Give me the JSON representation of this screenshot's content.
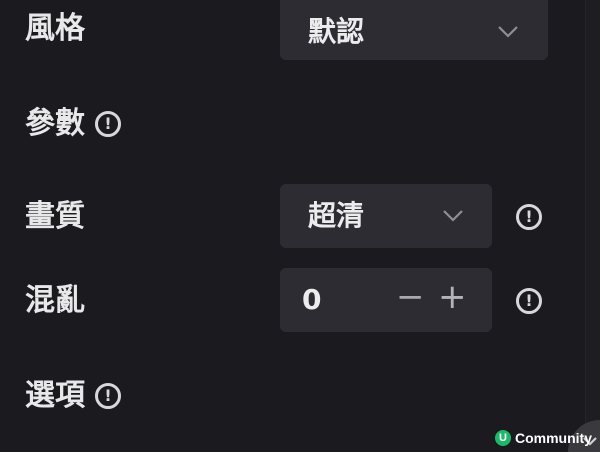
{
  "style": {
    "label": "風格",
    "selected": "默認"
  },
  "params": {
    "label": "參數",
    "info_glyph": "!"
  },
  "quality": {
    "label": "畫質",
    "selected": "超清",
    "info_glyph": "!"
  },
  "chaos": {
    "label": "混亂",
    "value": "0",
    "minus": "−",
    "plus": "+",
    "info_glyph": "!"
  },
  "options": {
    "label": "選項",
    "info_glyph": "!"
  },
  "watermark": {
    "logo_letter": "U",
    "text": "Community"
  },
  "icons": {
    "dropdown": "chevron-down-icon",
    "info": "info-circle-icon"
  },
  "colors": {
    "background": "#1b1a1f",
    "control": "#2d2c32",
    "text": "#e8e8ea",
    "muted": "#a9a9ae",
    "watermark_logo": "#1fb86a"
  }
}
